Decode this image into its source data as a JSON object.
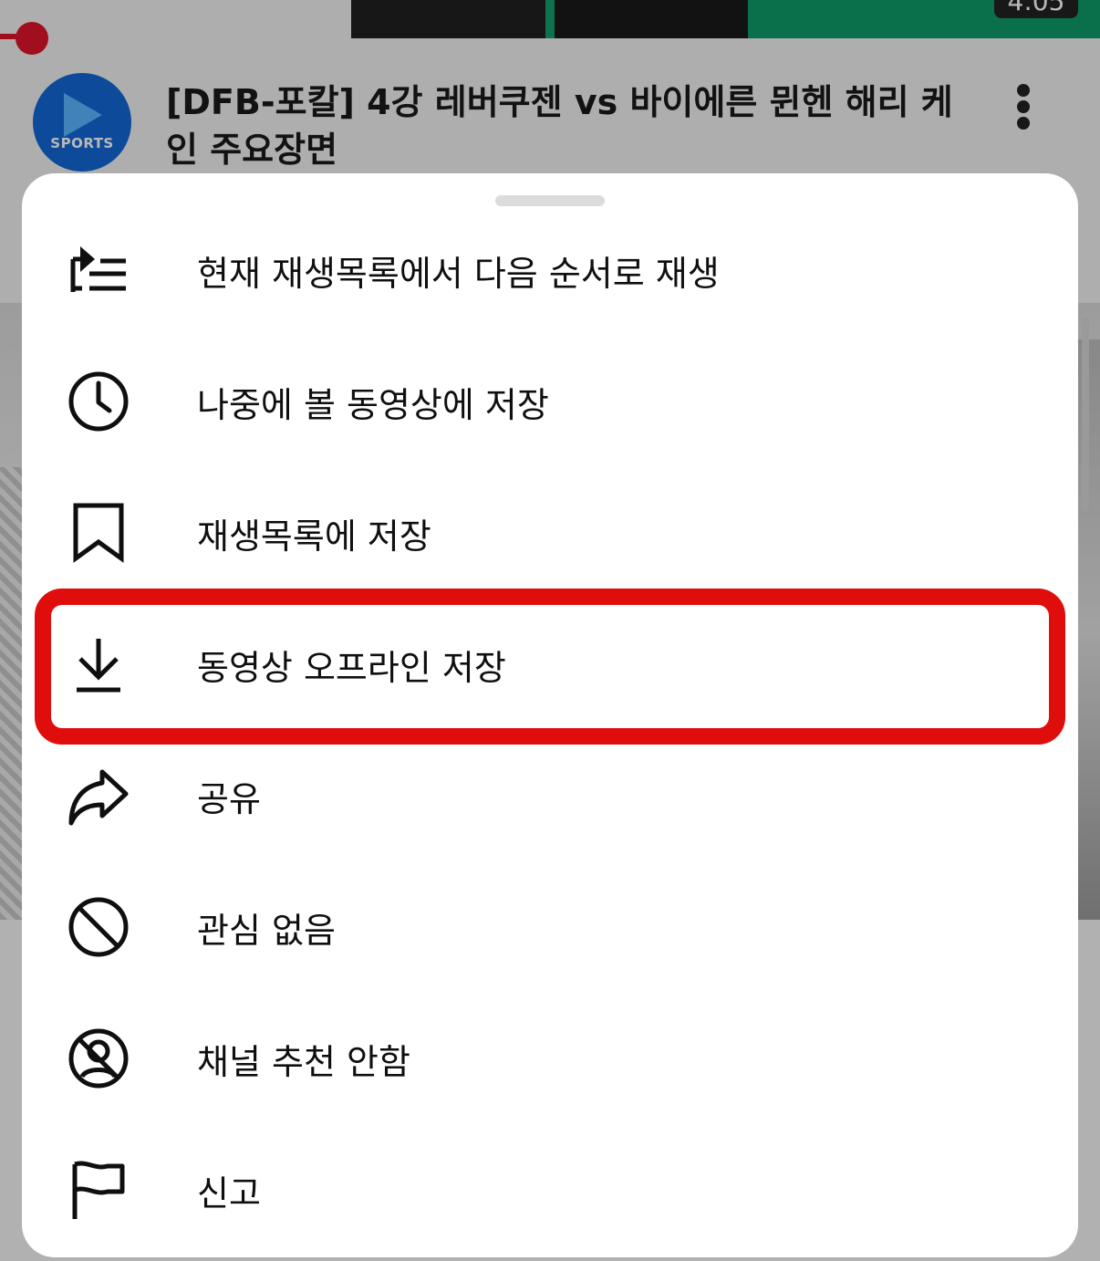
{
  "background": {
    "video_title": "[DFB-포칼] 4강 레버쿠젠 vs 바이에른 뮌헨 해리 케인 주요장면",
    "duration": "4:05",
    "channel_logo_text": "SPORTS",
    "colors": {
      "progress": "#e0142a",
      "avatar": "#1268d6"
    }
  },
  "menu": {
    "items": [
      {
        "label": "현재 재생목록에서 다음 순서로 재생",
        "icon": "play-next-in-queue-icon"
      },
      {
        "label": "나중에 볼 동영상에 저장",
        "icon": "clock-icon"
      },
      {
        "label": "재생목록에 저장",
        "icon": "bookmark-icon"
      },
      {
        "label": "동영상 오프라인 저장",
        "icon": "download-icon",
        "highlighted": true
      },
      {
        "label": "공유",
        "icon": "share-arrow-icon"
      },
      {
        "label": "관심 없음",
        "icon": "block-icon"
      },
      {
        "label": "채널 추천 안함",
        "icon": "no-channel-icon"
      },
      {
        "label": "신고",
        "icon": "flag-icon"
      }
    ],
    "highlight_color": "#e00d0d"
  }
}
